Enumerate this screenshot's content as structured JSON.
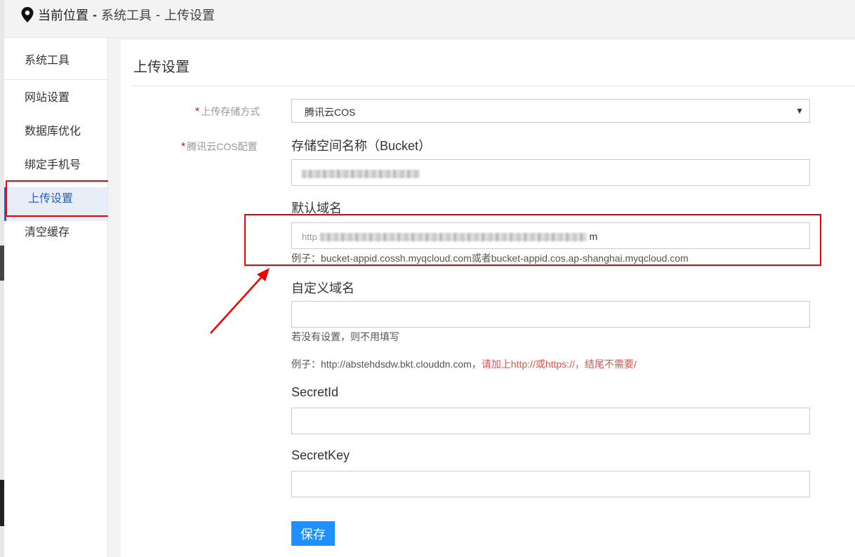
{
  "breadcrumb": {
    "current_label": "当前位置",
    "separator": "-",
    "items": [
      "系统工具",
      "上传设置"
    ]
  },
  "sidebar": {
    "header": "系统工具",
    "items": [
      {
        "label": "网站设置"
      },
      {
        "label": "数据库优化"
      },
      {
        "label": "绑定手机号"
      },
      {
        "label": "上传设置",
        "active": true
      },
      {
        "label": "清空缓存"
      }
    ]
  },
  "main": {
    "title": "上传设置",
    "storage": {
      "label": "上传存储方式",
      "selected": "腾讯云COS"
    },
    "cos_config_label": "腾讯云COS配置",
    "bucket": {
      "title": "存储空间名称（Bucket）",
      "value_redacted": true
    },
    "default_domain": {
      "title": "默认域名",
      "value_visible_prefix": "http",
      "value_visible_suffix": "m",
      "example": "例子：bucket-appid.cossh.myqcloud.com或者bucket-appid.cos.ap-shanghai.myqcloud.com"
    },
    "custom_domain": {
      "title": "自定义域名",
      "value": "",
      "note": "若没有设置，则不用填写",
      "example_prefix": "例子：http://abstehdsdw.bkt.clouddn.com，",
      "example_warning": "请加上http://或https://，结尾不需要/"
    },
    "secret_id": {
      "title": "SecretId",
      "value": ""
    },
    "secret_key": {
      "title": "SecretKey",
      "value": ""
    },
    "save_label": "保存"
  },
  "colors": {
    "accent": "#1e90ff",
    "active_nav": "#2462c5",
    "annotation": "#e00000",
    "warning_text": "#d9534f"
  }
}
